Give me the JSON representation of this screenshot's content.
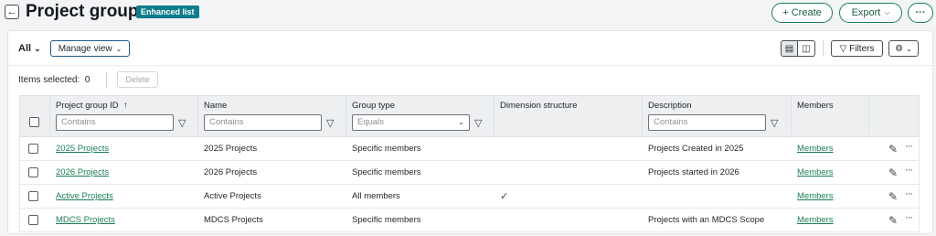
{
  "header": {
    "back_icon": "arrow-left-icon",
    "title": "Project groups",
    "badge": "Enhanced list",
    "create_label": "+ Create",
    "export_label": "Export",
    "more_label": "···"
  },
  "toolbar": {
    "view_select": "All",
    "manage_view": "Manage view",
    "filters": "Filters"
  },
  "selection": {
    "label": "Items selected:",
    "count": "0",
    "delete": "Delete"
  },
  "columns": [
    {
      "label": "Project group ID",
      "sort": "↑",
      "placeholder": "Contains"
    },
    {
      "label": "Name",
      "placeholder": "Contains"
    },
    {
      "label": "Group type",
      "placeholder": "Equals"
    },
    {
      "label": "Dimension structure"
    },
    {
      "label": "Description",
      "placeholder": "Contains"
    },
    {
      "label": "Members"
    }
  ],
  "rows": [
    {
      "id": "2025 Projects",
      "name": "2025 Projects",
      "type": "Specific members",
      "dim": "",
      "desc": "Projects Created in 2025",
      "members": "Members"
    },
    {
      "id": "2026 Projects",
      "name": "2026 Projects",
      "type": "Specific members",
      "dim": "",
      "desc": "Projects started in 2026",
      "members": "Members"
    },
    {
      "id": "Active Projects",
      "name": "Active Projects",
      "type": "All members",
      "dim": "✓",
      "desc": "",
      "members": "Members"
    },
    {
      "id": "MDCS Projects",
      "name": "MDCS Projects",
      "type": "Specific members",
      "dim": "",
      "desc": "Projects with an MDCS Scope",
      "members": "Members"
    }
  ],
  "colors": {
    "accent": "#1a7f54",
    "badge": "#0f7d8c"
  }
}
